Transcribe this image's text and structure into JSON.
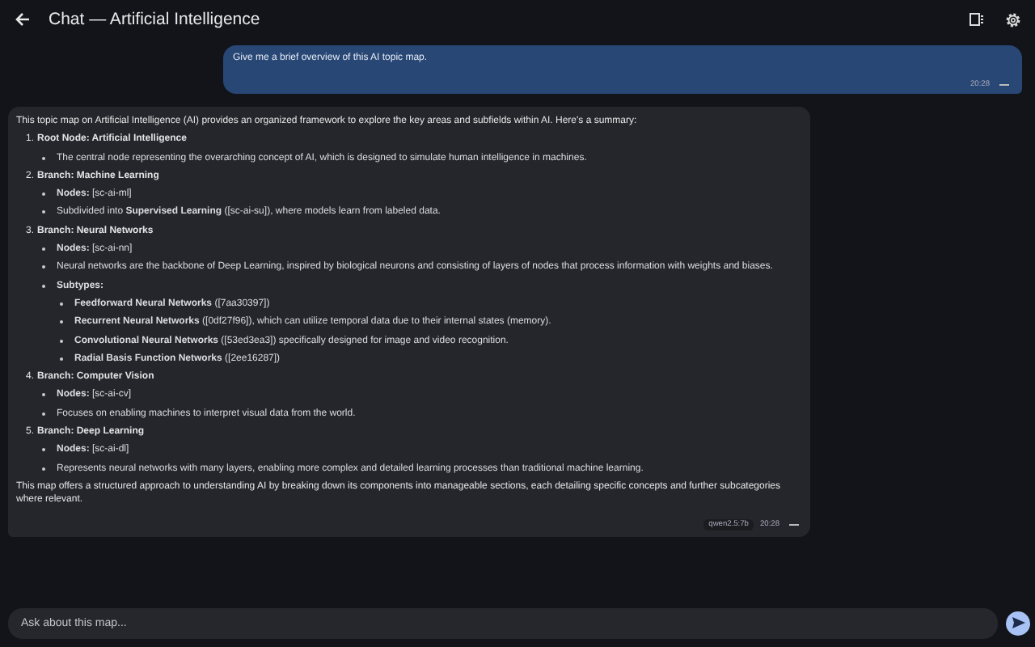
{
  "header": {
    "title": "Chat — Artificial Intelligence"
  },
  "messages": [
    {
      "kind": "user",
      "text": "Give me a brief overview of this AI topic map.",
      "time": "20:28"
    },
    {
      "kind": "assistant",
      "intro": "This topic map on Artificial Intelligence (AI) provides an organized framework to explore the key areas and subfields within AI. Here's a summary:",
      "items": [
        {
          "number": "1.",
          "title": "Root Node: Artificial Intelligence",
          "children": [
            {
              "text": "The central node representing the overarching concept of AI, which is designed to simulate human intelligence in machines."
            }
          ]
        },
        {
          "number": "2.",
          "title": "Branch: Machine Learning",
          "children": [
            {
              "text": "**Nodes:** [sc-ai-ml]"
            },
            {
              "text": "Subdivided into **Supervised Learning** ([sc-ai-su]), where models learn from labeled data."
            }
          ]
        },
        {
          "number": "3.",
          "title": "Branch: Neural Networks",
          "children": [
            {
              "text": "**Nodes:** [sc-ai-nn]"
            },
            {
              "text": "Neural networks are the backbone of Deep Learning, inspired by biological neurons and consisting of layers of nodes that process information with weights and biases."
            },
            {
              "text": "Subtypes:",
              "strong": true,
              "children": [
                {
                  "text": "**Feedforward Neural Networks** ([7aa30397])"
                },
                {
                  "text": "**Recurrent Neural Networks** ([0df27f96]), which can utilize temporal data due to their internal states (memory)."
                },
                {
                  "text": "**Convolutional Neural Networks** ([53ed3ea3]) specifically designed for image and video recognition."
                },
                {
                  "text": "**Radial Basis Function Networks** ([2ee16287])"
                }
              ]
            }
          ]
        },
        {
          "number": "4.",
          "title": "Branch: Computer Vision",
          "children": [
            {
              "text": "**Nodes:** [sc-ai-cv]"
            },
            {
              "text": "Focuses on enabling machines to interpret visual data from the world."
            }
          ]
        },
        {
          "number": "5.",
          "title": "Branch: Deep Learning",
          "children": [
            {
              "text": "**Nodes:** [sc-ai-dl]"
            },
            {
              "text": "Represents neural networks with many layers, enabling more complex and detailed learning processes than traditional machine learning."
            }
          ]
        }
      ],
      "outro": "This map offers a structured approach to understanding AI by breaking down its components into manageable sections, each detailing specific concepts and further subcategories where relevant.",
      "model": "qwen2.5:7b",
      "time": "20:28"
    }
  ],
  "composer": {
    "placeholder": "Ask about this map..."
  }
}
